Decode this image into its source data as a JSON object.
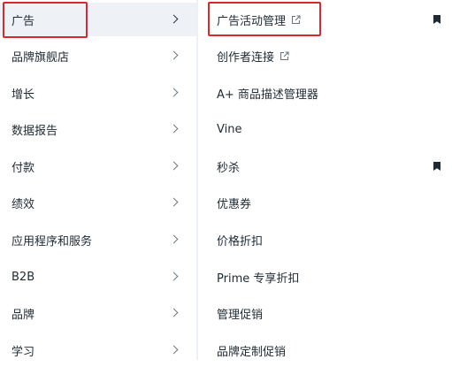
{
  "left_menu": {
    "items": [
      {
        "label": "广告"
      },
      {
        "label": "品牌旗舰店"
      },
      {
        "label": "增长"
      },
      {
        "label": "数据报告"
      },
      {
        "label": "付款"
      },
      {
        "label": "绩效"
      },
      {
        "label": "应用程序和服务"
      },
      {
        "label": "B2B"
      },
      {
        "label": "品牌"
      },
      {
        "label": "学习"
      }
    ],
    "active_index": 0
  },
  "right_menu": {
    "items": [
      {
        "label": "广告活动管理",
        "external": true,
        "bookmarked": true
      },
      {
        "label": "创作者连接",
        "external": true,
        "bookmarked": false
      },
      {
        "label": "A+ 商品描述管理器",
        "external": false,
        "bookmarked": false
      },
      {
        "label": "Vine",
        "external": false,
        "bookmarked": false
      },
      {
        "label": "秒杀",
        "external": false,
        "bookmarked": true
      },
      {
        "label": "优惠券",
        "external": false,
        "bookmarked": false
      },
      {
        "label": "价格折扣",
        "external": false,
        "bookmarked": false
      },
      {
        "label": "Prime 专享折扣",
        "external": false,
        "bookmarked": false
      },
      {
        "label": "管理促销",
        "external": false,
        "bookmarked": false
      },
      {
        "label": "品牌定制促销",
        "external": false,
        "bookmarked": false
      }
    ]
  },
  "colors": {
    "highlight_box": "#d32b2b",
    "active_row_bg": "#eef2f6",
    "text": "#1f2a33",
    "bookmark": "#1f2a33"
  }
}
